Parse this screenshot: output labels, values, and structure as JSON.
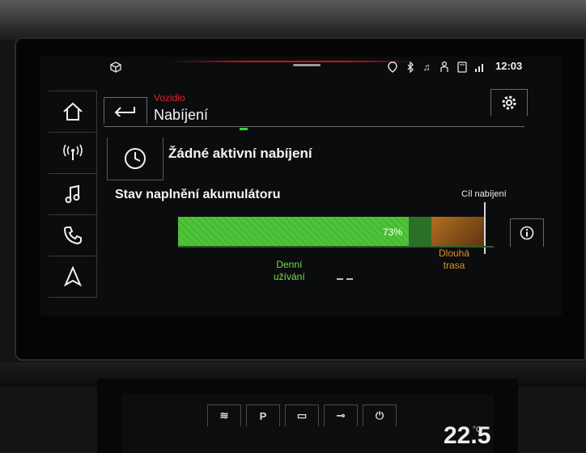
{
  "status_bar": {
    "time": "12:03",
    "icons": [
      "car-icon",
      "navigation-alert-icon",
      "bluetooth-icon",
      "music-note-icon",
      "person-icon",
      "phone-icon",
      "signal-icon"
    ]
  },
  "nav": {
    "items": [
      {
        "name": "home-icon"
      },
      {
        "name": "radio-icon"
      },
      {
        "name": "music-icon"
      },
      {
        "name": "phone-icon"
      },
      {
        "name": "navigation-icon"
      }
    ]
  },
  "header": {
    "breadcrumb": "Vozidlo",
    "title": "Nabíjení"
  },
  "charging": {
    "status": "Žádné aktivní nabíjení",
    "battery_label": "Stav naplnění akumulátoru",
    "level_percent": 73,
    "level_text": "73%",
    "target_label": "Cíl nabíjení",
    "zone_daily": [
      "Denní",
      "užívání"
    ],
    "zone_long": [
      "Dlouhá",
      "trasa"
    ]
  },
  "colors": {
    "accent_red": "#e0242b",
    "charge_green": "#4ec53a",
    "long_trip_orange": "#e0912a"
  },
  "lower_display": {
    "temperature": "22.5",
    "temperature_unit": "°C"
  }
}
